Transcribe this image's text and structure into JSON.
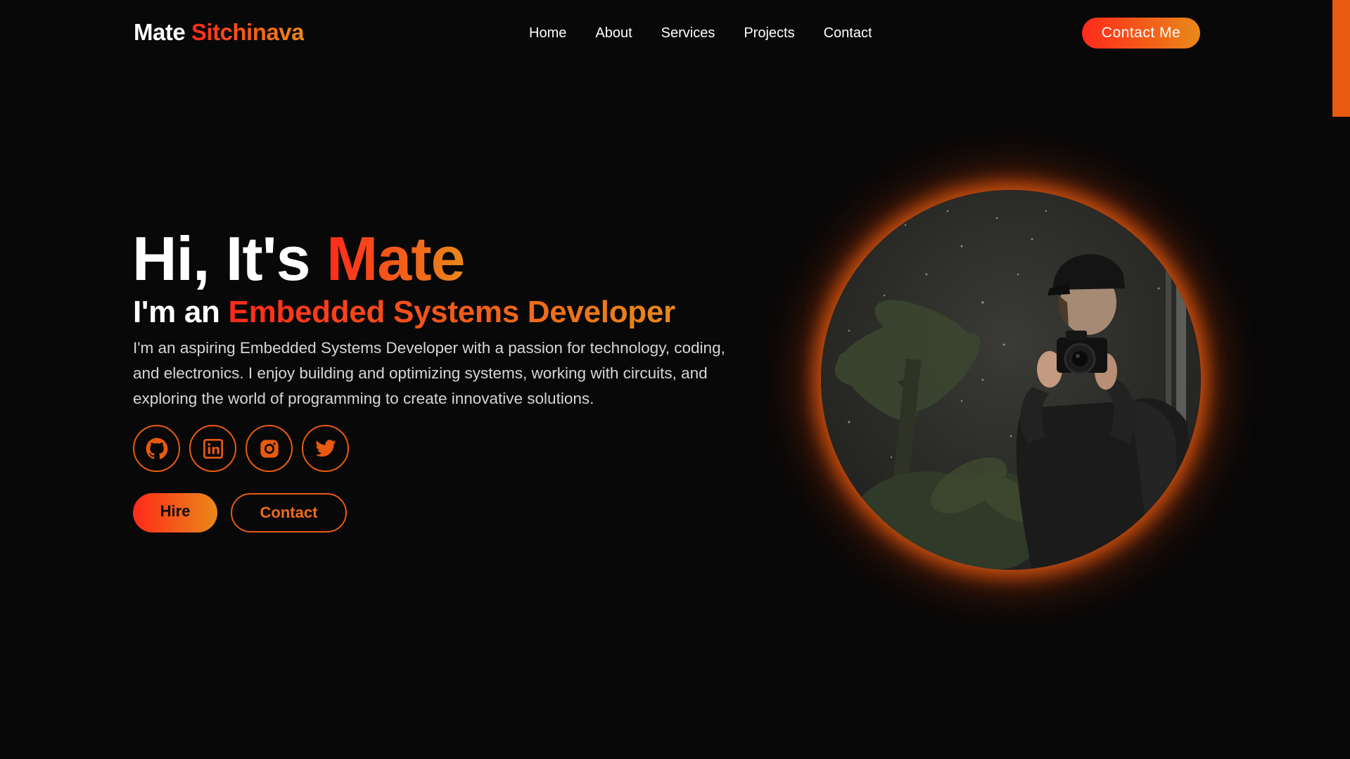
{
  "header": {
    "logo_first": "Mate",
    "logo_last": "Sitchinava",
    "nav": [
      "Home",
      "About",
      "Services",
      "Projects",
      "Contact"
    ],
    "cta_label": "Contact Me"
  },
  "hero": {
    "greeting": "Hi, It's ",
    "name": "Mate",
    "role_prefix": "I'm an ",
    "role": "Embedded Systems Developer",
    "description": "I'm an aspiring Embedded Systems Developer with a passion for technology, coding, and electronics. I enjoy building and optimizing systems, working with circuits, and exploring the world of programming to create innovative solutions.",
    "socials": [
      {
        "icon": "github-icon"
      },
      {
        "icon": "linkedin-icon"
      },
      {
        "icon": "instagram-icon"
      },
      {
        "icon": "twitter-icon"
      }
    ],
    "hire_label": "Hire",
    "contact_label": "Contact"
  },
  "colors": {
    "background": "#080808",
    "accent_start": "#ff2a1a",
    "accent_end": "#e8891a",
    "accent_border": "#e85a10",
    "text": "#ffffff",
    "text_muted": "#d6d6d6"
  }
}
